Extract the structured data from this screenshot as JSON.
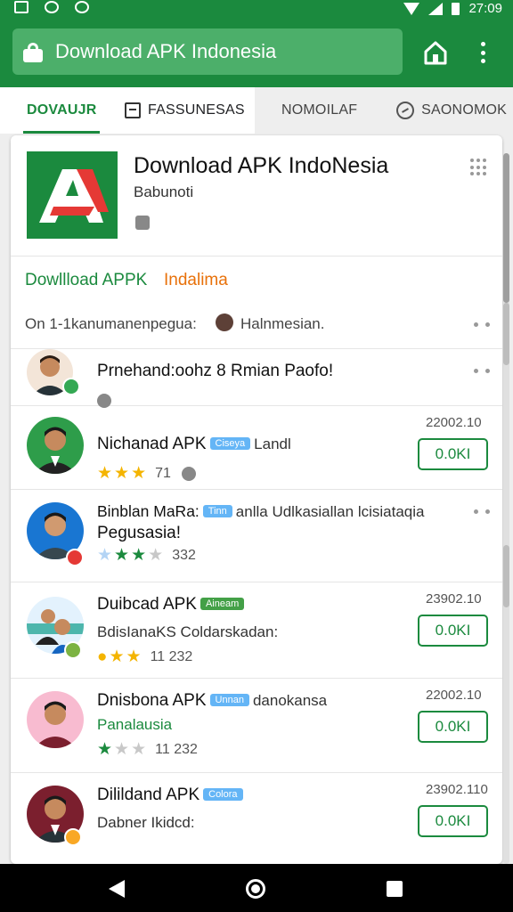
{
  "status_bar": {
    "time": "27:09"
  },
  "browser": {
    "url_text": "Download APK Indonesia"
  },
  "tabs": [
    {
      "label": "DOVAUJR"
    },
    {
      "label": "FASSUNESAS"
    },
    {
      "label": "NOMOILAF"
    },
    {
      "label": "SAONOMOK"
    }
  ],
  "app": {
    "title": "Download APK IndoNesia",
    "subtitle": "Babunoti",
    "download_label": "Dowllload APPK",
    "download_label_alt": "Indalima",
    "info_text": "On 1-1kanumanenpegua:",
    "info_name": "Halnmesian."
  },
  "items": [
    {
      "title": "Prnehand:oohz 8 Rmian Paofo!"
    },
    {
      "title": "Nichanad APK",
      "badge": "Ciseya",
      "extra": "Landl",
      "rating": "71",
      "version": "22002.10",
      "button": "0.0KI"
    },
    {
      "title": "Binblan MaRa:",
      "badge": "Tinn",
      "extra": "anlla Udlkasiallan lcisiataqia",
      "subtitle": "Pegusasia!",
      "rating": "332"
    },
    {
      "title": "Duibcad APK",
      "badge": "Aineam",
      "subtitle": "BdisIanaKS Coldarskadan:",
      "rating": "11 232",
      "version": "23902.10",
      "button": "0.0KI"
    },
    {
      "title": "Dnisbona APK",
      "badge": "Unnan",
      "extra": "danokansa",
      "subtitle": "Panalausia",
      "rating": "11 232",
      "version": "22002.10",
      "button": "0.0KI"
    },
    {
      "title": "Dilildand APK",
      "badge": "Colora",
      "subtitle": "Dabner Ikidcd:",
      "version": "23902.110",
      "button": "0.0KI"
    }
  ],
  "colors": {
    "brand_green": "#1b8a3e",
    "accent_orange": "#e8710a",
    "star_yellow": "#f4b400",
    "badge_blue": "#64b5f6"
  },
  "icons": [
    "lock-icon",
    "home-icon",
    "menu-icon",
    "grid-icon",
    "share-icon",
    "back-icon",
    "circle-home-icon",
    "recents-icon"
  ]
}
